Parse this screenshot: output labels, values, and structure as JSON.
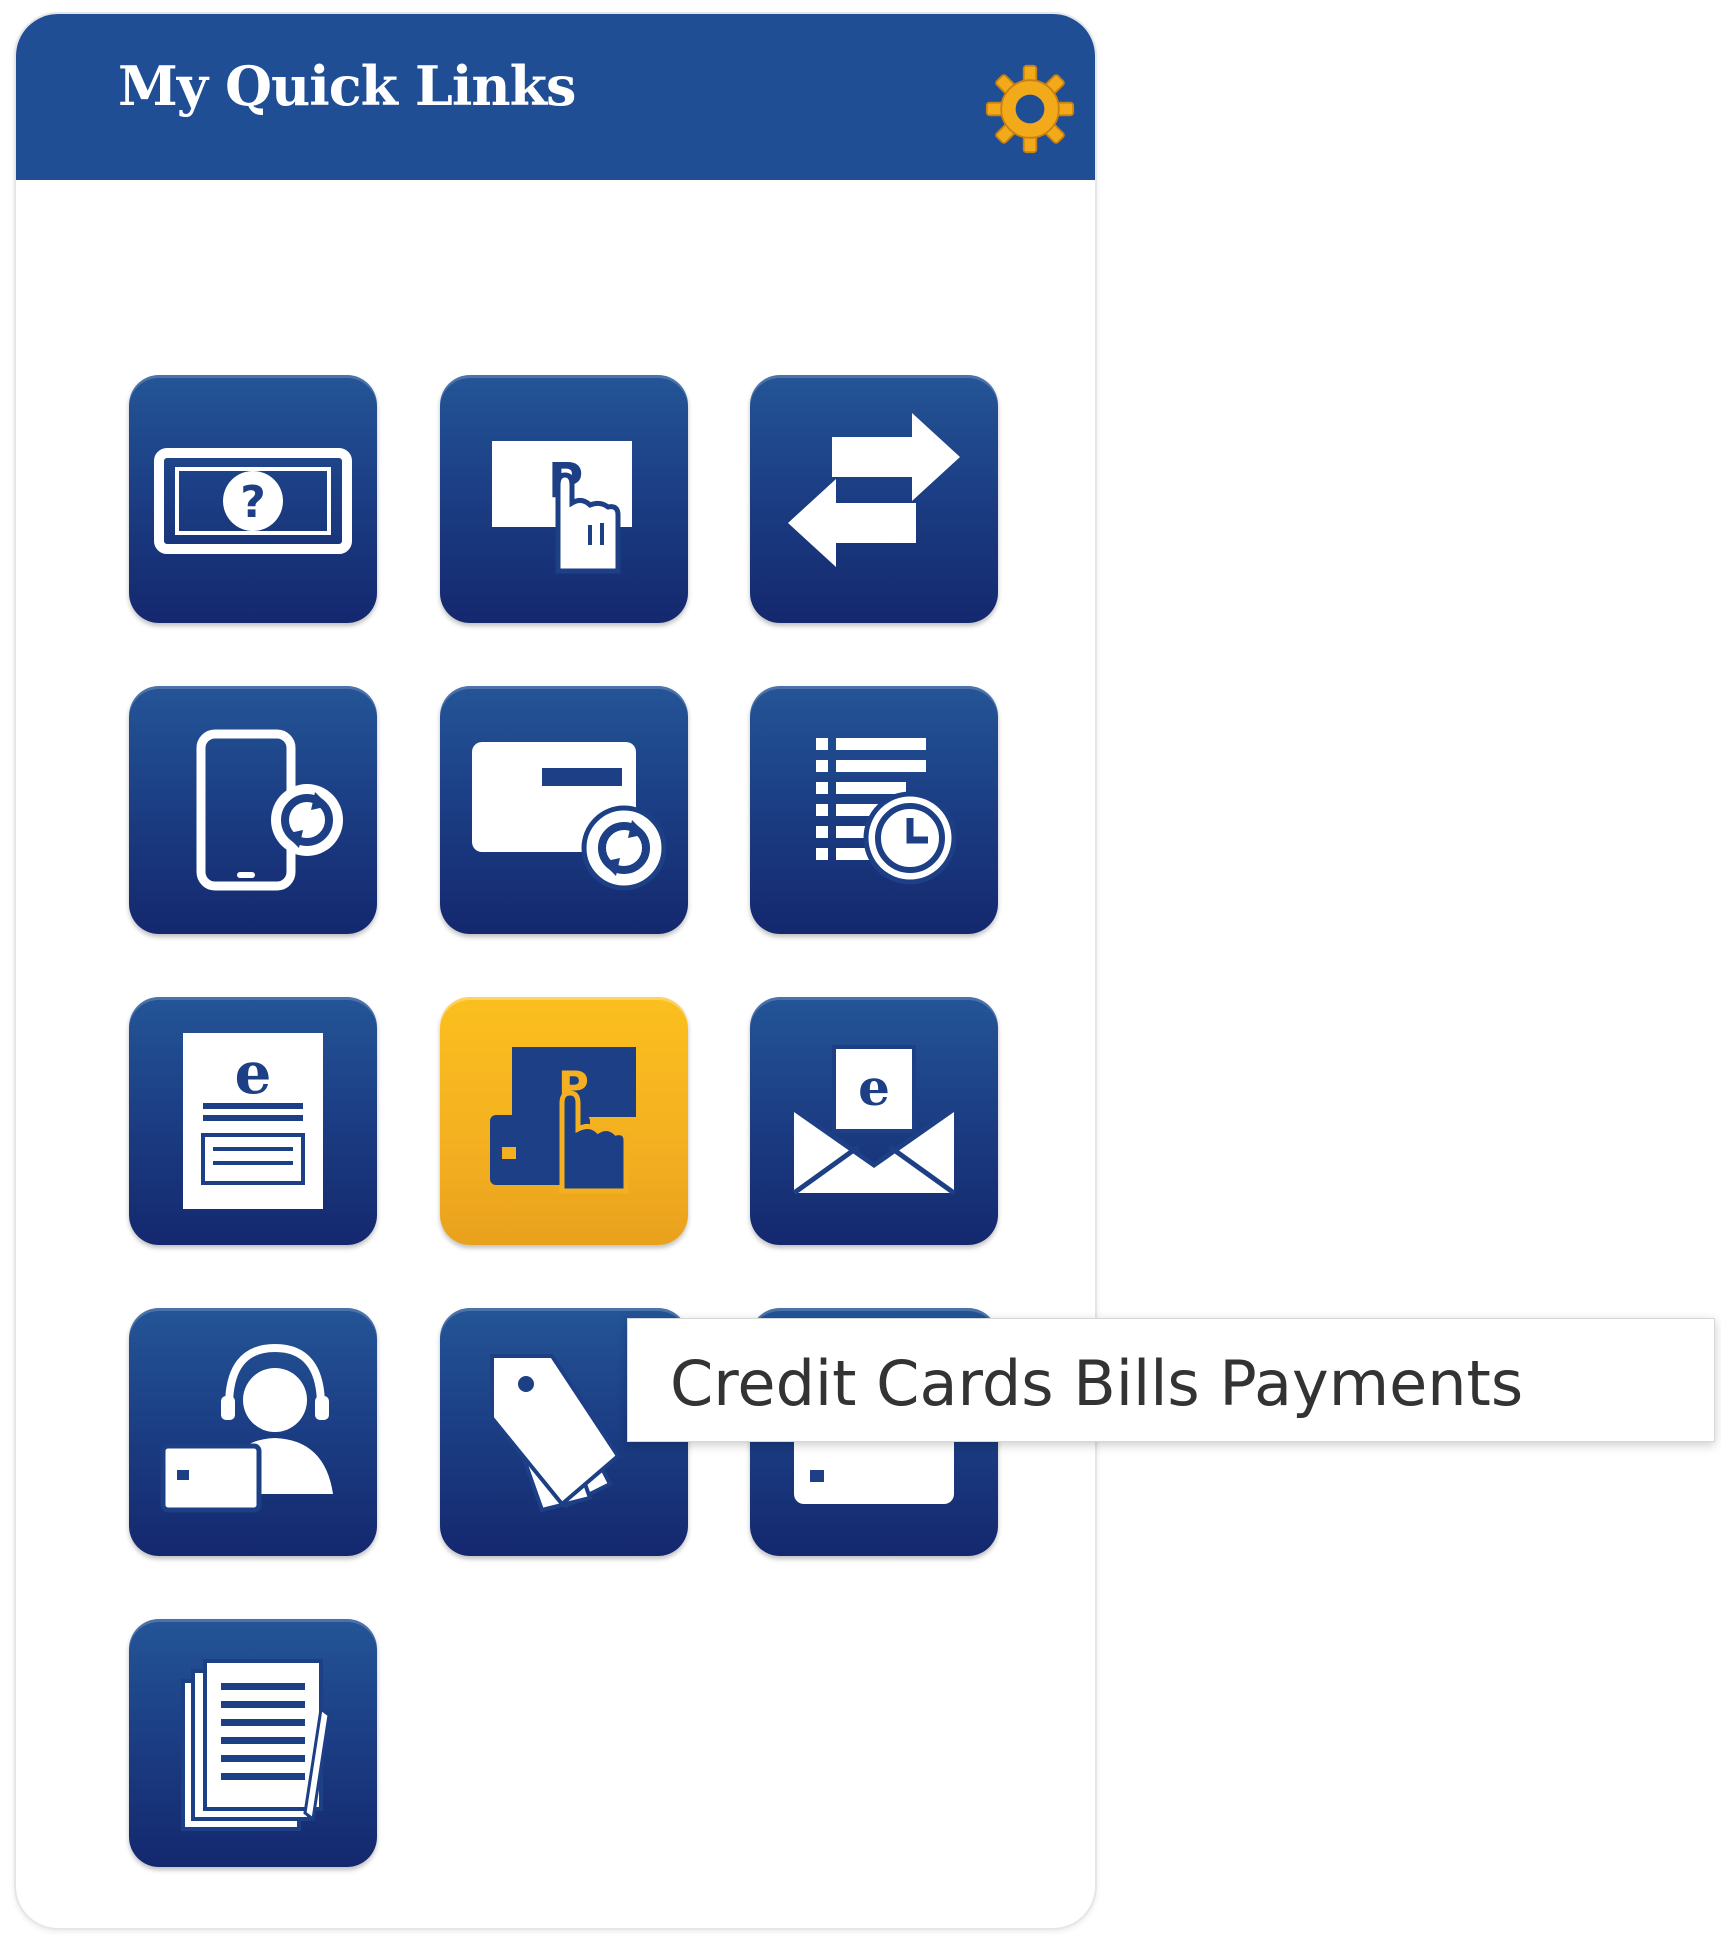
{
  "panel": {
    "title": "My Quick Links",
    "settings_icon": "gear-icon",
    "settings_icon_color": "#f2a91a"
  },
  "colors": {
    "header": "#1f4e94",
    "tile": "#1c3f85",
    "tile_active": "#f4b021"
  },
  "tiles": [
    {
      "icon": "money-question-icon"
    },
    {
      "icon": "touch-payment-icon"
    },
    {
      "icon": "transfer-arrows-icon"
    },
    {
      "icon": "mobile-refresh-icon"
    },
    {
      "icon": "card-refresh-icon"
    },
    {
      "icon": "scheduled-list-icon"
    },
    {
      "icon": "e-statement-icon"
    },
    {
      "icon": "credit-card-payment-icon",
      "active": true
    },
    {
      "icon": "e-mail-icon"
    },
    {
      "icon": "customer-support-icon"
    },
    {
      "icon": "tags-icon"
    },
    {
      "icon": "card-icon"
    },
    {
      "icon": "documents-icon"
    }
  ],
  "tooltip": {
    "text": "Credit Cards Bills Payments"
  }
}
